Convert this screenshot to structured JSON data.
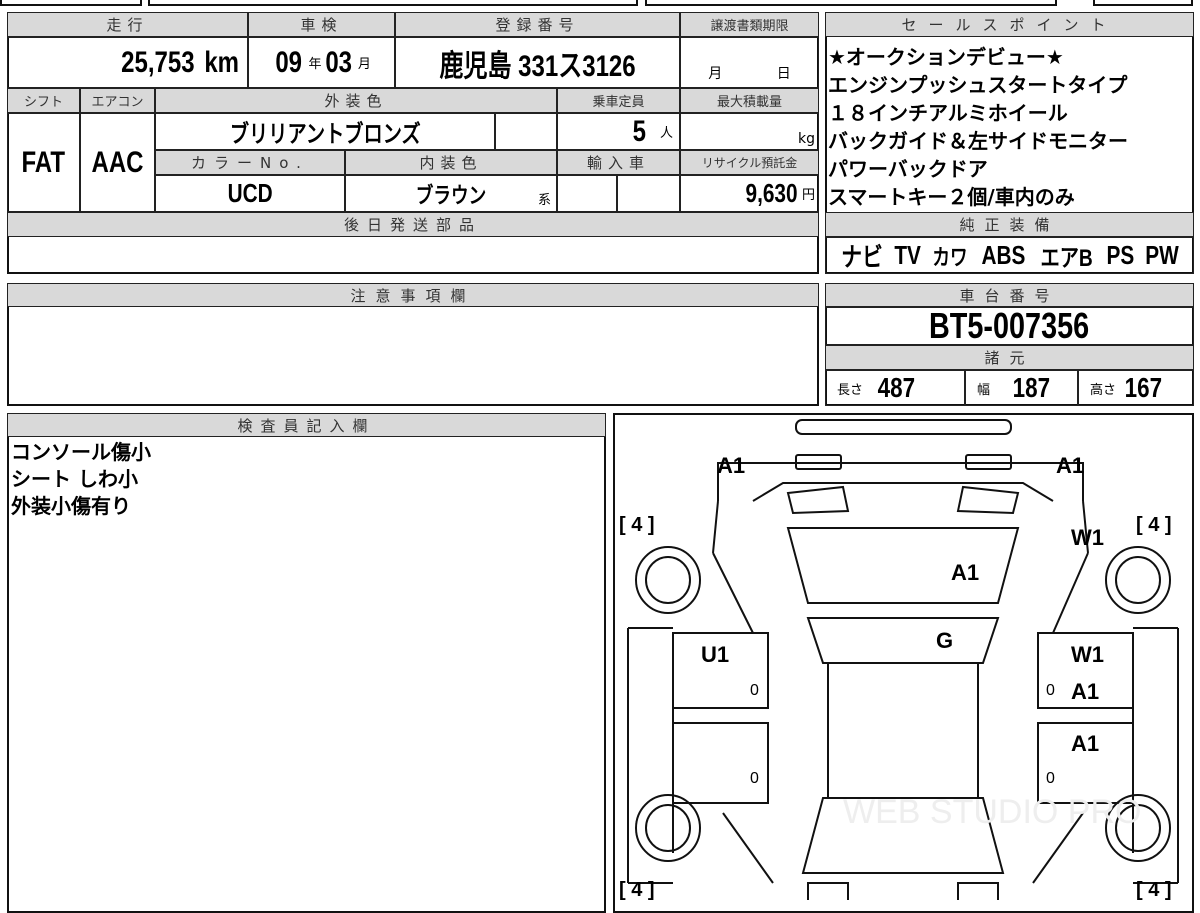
{
  "headers": {
    "mileage": "走行",
    "inspection": "車検",
    "registration": "登録番号",
    "transfer_deadline": "譲渡書類期限",
    "shift": "シフト",
    "aircon": "エアコン",
    "exterior_color": "外装色",
    "capacity": "乗車定員",
    "max_load": "最大積載量",
    "color_no": "カラーNo.",
    "interior_color": "内装色",
    "import": "輸入車",
    "recycle": "リサイクル預託金",
    "later_parts": "後日発送部品",
    "sales_points": "セールスポイント",
    "genuine_equipment": "純正装備",
    "notes": "注意事項欄",
    "chassis_no": "車台番号",
    "specs": "諸元",
    "inspector_notes": "検査員記入欄"
  },
  "values": {
    "mileage": "25,753",
    "mileage_unit": "km",
    "inspection_year": "09",
    "year_unit": "年",
    "inspection_month": "03",
    "month_unit": "月",
    "registration": "鹿児島 331ス3126",
    "transfer_month": "月",
    "transfer_day": "日",
    "shift": "FAT",
    "aircon": "AAC",
    "exterior_color": "ブリリアントブロンズ",
    "capacity": "5",
    "capacity_unit": "人",
    "max_load_unit": "kg",
    "color_no": "UCD",
    "interior_color": "ブラウン",
    "interior_suffix": "系",
    "recycle": "9,630",
    "recycle_unit": "円"
  },
  "sales_points": [
    "★オークションデビュー★",
    "エンジンプッシュスタートタイプ",
    "１８インチアルミホイール",
    "バックガイド＆左サイドモニター",
    "パワーバックドア",
    "スマートキー２個/車内のみ"
  ],
  "equipment": [
    "ナビ",
    "TV",
    "カワ",
    "ABS",
    "エアB",
    "PS",
    "PW"
  ],
  "chassis_no": "BT5-007356",
  "specs": {
    "length_label": "長さ",
    "length": "487",
    "width_label": "幅",
    "width": "187",
    "height_label": "高さ",
    "height": "167"
  },
  "inspector_notes": [
    "コンソール傷小",
    "シート しわ小",
    "外装小傷有り"
  ],
  "diagram": {
    "front_left": "A1",
    "front_right": "A1",
    "roof": "A1",
    "glass": "G",
    "w_rf": "W1",
    "w_rf2": "W1",
    "u_lf": "U1",
    "a_rf": "A1",
    "a_rr": "A1",
    "tyre": "[ 4 ]",
    "zero": "0",
    "watermark": "WEB STUDIO PRO"
  }
}
